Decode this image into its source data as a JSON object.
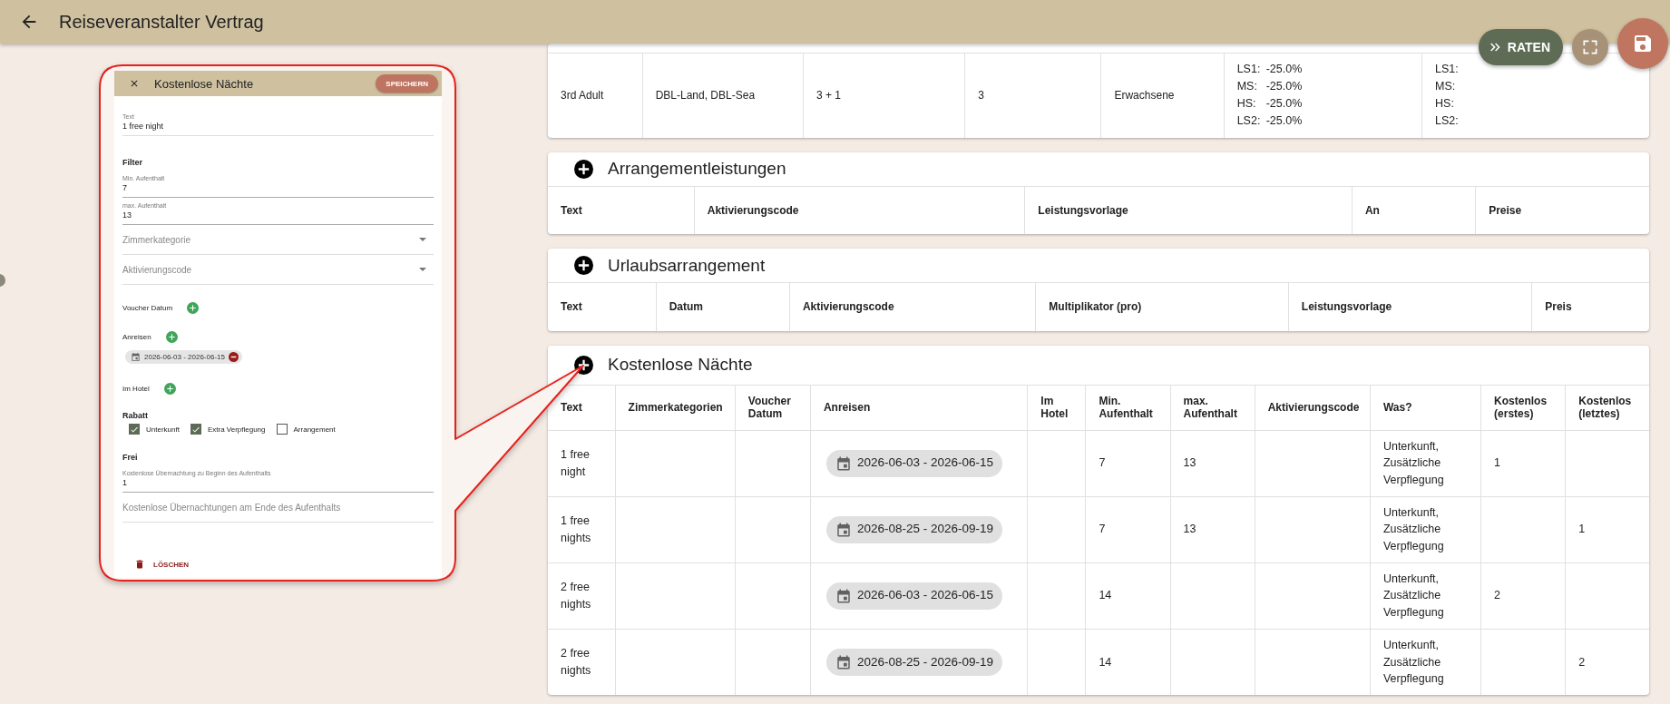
{
  "app_bar": {
    "title": "Reiseveranstalter Vertrag"
  },
  "actions": [
    {
      "kind": "raten",
      "label": "RATEN"
    },
    {
      "kind": "fullscreen"
    },
    {
      "kind": "save"
    }
  ],
  "dialog": {
    "title": "Kostenlose Nächte",
    "save_label": "SPEICHERN",
    "text_field": {
      "label": "Text",
      "value": "1 free night"
    },
    "filter_heading": "Filter",
    "filter_fields": [
      {
        "kind": "input",
        "label": "Min. Aufenthalt",
        "value": "7"
      },
      {
        "kind": "input",
        "label": "max. Aufenthalt",
        "value": "13"
      },
      {
        "kind": "select",
        "placeholder": "Zimmerkategorie"
      },
      {
        "kind": "select",
        "placeholder": "Aktivierungscode"
      }
    ],
    "adders": [
      {
        "label": "Voucher Datum"
      },
      {
        "label": "Anreisen",
        "chips": [
          "2026-06-03 - 2026-06-15"
        ]
      },
      {
        "label": "Im Hotel"
      }
    ],
    "rabatt": {
      "heading": "Rabatt",
      "options": [
        {
          "label": "Unterkunft",
          "checked": true
        },
        {
          "label": "Extra Verpflegung",
          "checked": true
        },
        {
          "label": "Arrangement",
          "checked": false
        }
      ]
    },
    "frei": {
      "heading": "Frei",
      "fields": [
        {
          "label": "Kostenlose Übernachtung zu Beginn des Aufenthalts",
          "value": "1"
        },
        {
          "placeholder": "Kostenlose Übernachtungen am Ende des Aufenthalts"
        }
      ]
    },
    "delete_label": "LÖSCHEN"
  },
  "pricing_table": {
    "rows": [
      {
        "cells": [
          "3rd Adult",
          "DBL-Land, DBL-Sea",
          "3 + 1",
          "3",
          "Erwachsene"
        ],
        "column_6": [
          {
            "label": "LS1:",
            "value": "-25.0%"
          },
          {
            "label": "MS:",
            "value": "-25.0%"
          },
          {
            "label": "HS:",
            "value": "-25.0%"
          },
          {
            "label": "LS2:",
            "value": "-25.0%"
          }
        ],
        "column_7": [
          "LS1:",
          "MS:",
          "HS:",
          "LS2:"
        ]
      }
    ]
  },
  "sections": [
    {
      "title": "Arrangementleistungen",
      "columns": [
        "Text",
        "Aktivierungscode",
        "Leistungsvorlage",
        "An",
        "Preise"
      ]
    },
    {
      "title": "Urlaubsarrangement",
      "columns": [
        "Text",
        "Datum",
        "Aktivierungscode",
        "Multiplikator (pro)",
        "Leistungsvorlage",
        "Preis"
      ]
    },
    {
      "title": "Kostenlose Nächte",
      "columns": [
        "Text",
        "Zimmerkategorien",
        "Voucher Datum",
        "Anreisen",
        "Im Hotel",
        "Min. Aufenthalt",
        "max. Aufenthalt",
        "Aktivierungscode",
        "Was?",
        "Kostenlos (erstes)",
        "Kostenlos (letztes)"
      ],
      "rows": [
        {
          "text": "1 free night",
          "arrival": "2026-06-03 - 2026-06-15",
          "min_stay": "7",
          "max_stay": "13",
          "what": "Unterkunft, Zusätzliche Verpflegung",
          "free_first": "1"
        },
        {
          "text": "1 free nights",
          "arrival": "2026-08-25 - 2026-09-19",
          "min_stay": "7",
          "max_stay": "13",
          "what": "Unterkunft, Zusätzliche Verpflegung",
          "free_last": "1"
        },
        {
          "text": "2 free nights",
          "arrival": "2026-06-03 - 2026-06-15",
          "min_stay": "14",
          "what": "Unterkunft, Zusätzliche Verpflegung",
          "free_first": "2"
        },
        {
          "text": "2 free nights",
          "arrival": "2026-08-25 - 2026-09-19",
          "min_stay": "14",
          "what": "Unterkunft, Zusätzliche Verpflegung",
          "free_last": "2"
        }
      ]
    }
  ]
}
